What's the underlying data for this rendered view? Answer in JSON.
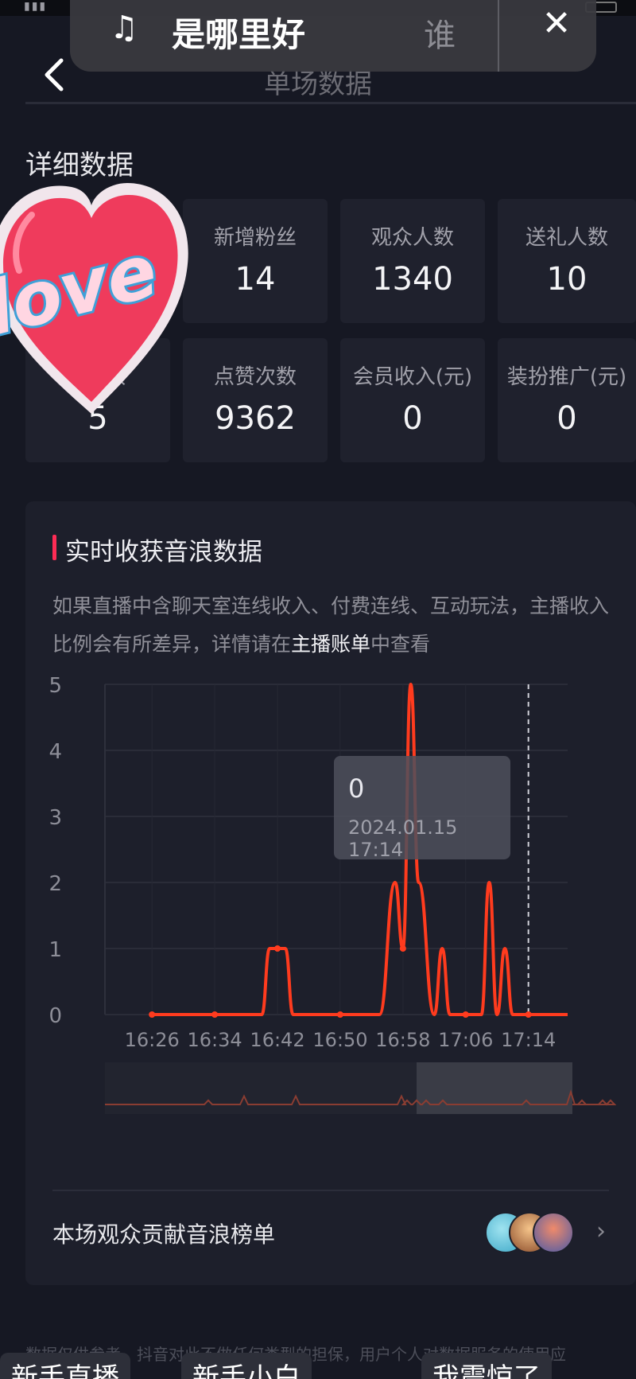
{
  "music": {
    "title": "是哪里好",
    "title_suffix": "谁",
    "close_icon": "close-icon"
  },
  "header": {
    "title": "单场数据"
  },
  "detail": {
    "title": "详细数据",
    "stats": [
      {
        "label": "新增粉丝",
        "value": "14"
      },
      {
        "label": "观众人数",
        "value": "1340"
      },
      {
        "label": "送礼人数",
        "value": "10"
      },
      {
        "label": "数",
        "value": "5"
      },
      {
        "label": "点赞次数",
        "value": "9362"
      },
      {
        "label": "会员收入(元)",
        "value": "0"
      },
      {
        "label": "装扮推广(元)",
        "value": "0"
      }
    ]
  },
  "sticker": {
    "text": "love"
  },
  "card": {
    "title": "实时收获音浪数据",
    "desc_before": "如果直播中含聊天室连线收入、付费连线、互动玩法，主播收入比例会有所差异，详情请在",
    "desc_highlight": "主播账单",
    "desc_after": "中查看"
  },
  "tooltip": {
    "value": "0",
    "time": "2024.01.15 17:14"
  },
  "chart_data": {
    "type": "line",
    "x": [
      "16:26",
      "16:34",
      "16:42",
      "16:50",
      "16:58",
      "17:06",
      "17:14"
    ],
    "yticks": [
      0,
      1,
      2,
      3,
      4,
      5
    ],
    "ylim": [
      0,
      5
    ],
    "series": [
      {
        "points": [
          [
            "16:26",
            0
          ],
          [
            "16:34",
            0
          ],
          [
            "16:40",
            0
          ],
          [
            "16:41",
            1
          ],
          [
            "16:42",
            1
          ],
          [
            "16:43",
            1
          ],
          [
            "16:44",
            0
          ],
          [
            "16:50",
            0
          ],
          [
            "16:55",
            0
          ],
          [
            "16:57",
            2
          ],
          [
            "16:58",
            1
          ],
          [
            "16:59",
            5
          ],
          [
            "17:00",
            2
          ],
          [
            "17:02",
            0
          ],
          [
            "17:03",
            1
          ],
          [
            "17:04",
            0
          ],
          [
            "17:06",
            0
          ],
          [
            "17:08",
            0
          ],
          [
            "17:09",
            2
          ],
          [
            "17:10",
            0
          ],
          [
            "17:11",
            1
          ],
          [
            "17:12",
            0
          ],
          [
            "17:14",
            0
          ],
          [
            "17:19",
            0
          ]
        ]
      }
    ],
    "cursor_x": "17:14",
    "color": "#ff3b1e"
  },
  "rank": {
    "label": "本场观众贡献音浪榜单"
  },
  "footer": {
    "disclaimer": "数据仅供参考，抖音对此不做任何类型的担保，用户个人对数据服务的使用应",
    "tabs": [
      "新手直播",
      "新手小白",
      "我震惊了"
    ]
  }
}
